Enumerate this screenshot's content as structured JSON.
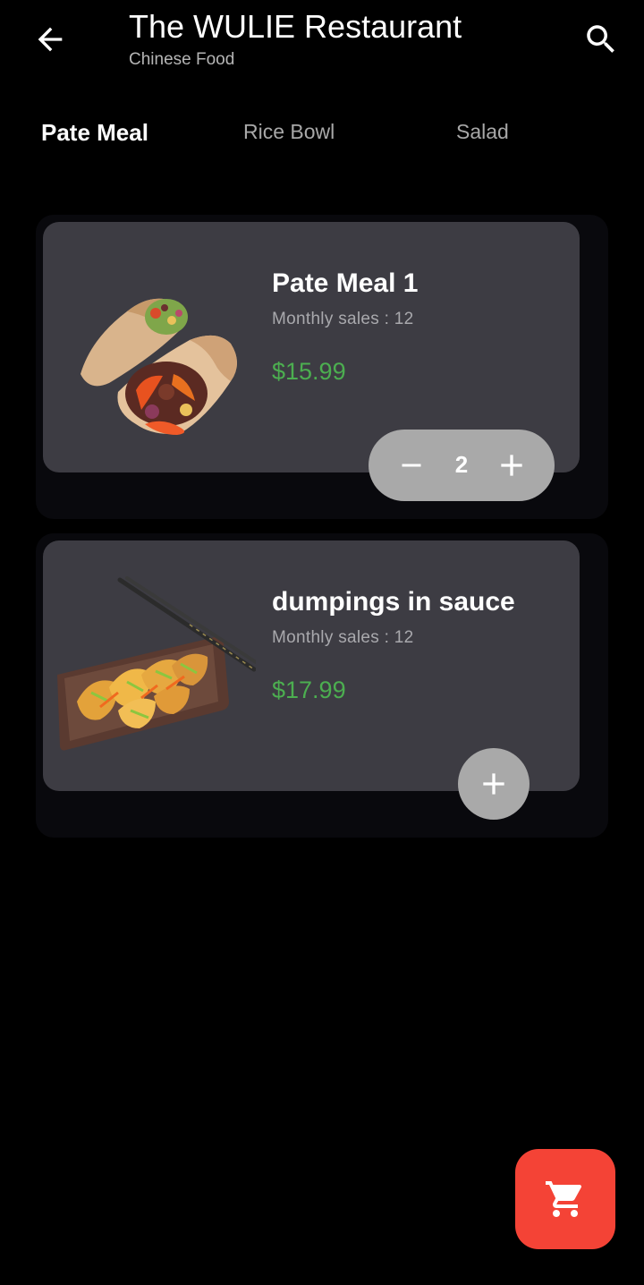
{
  "header": {
    "title": "The WULIE Restaurant",
    "subtitle": "Chinese Food",
    "back_icon": "arrow-back-icon",
    "search_icon": "search-icon"
  },
  "tabs": [
    {
      "label": "Pate Meal",
      "active": true
    },
    {
      "label": "Rice Bowl",
      "active": false
    },
    {
      "label": "Salad",
      "active": false
    }
  ],
  "items": [
    {
      "name": "Pate Meal 1",
      "sales": "Monthly sales : 12",
      "price": "$15.99",
      "quantity": "2",
      "image": "burrito-wrap-image"
    },
    {
      "name": "dumpings in sauce",
      "sales": "Monthly sales : 12",
      "price": "$17.99",
      "image": "dumplings-platter-image"
    }
  ],
  "cart": {
    "icon": "shopping-cart-icon"
  },
  "colors": {
    "background": "#000000",
    "card": "#3d3c43",
    "price": "#4cae50",
    "cart_button": "#f44336",
    "quantity_control": "#a9a9a9"
  }
}
